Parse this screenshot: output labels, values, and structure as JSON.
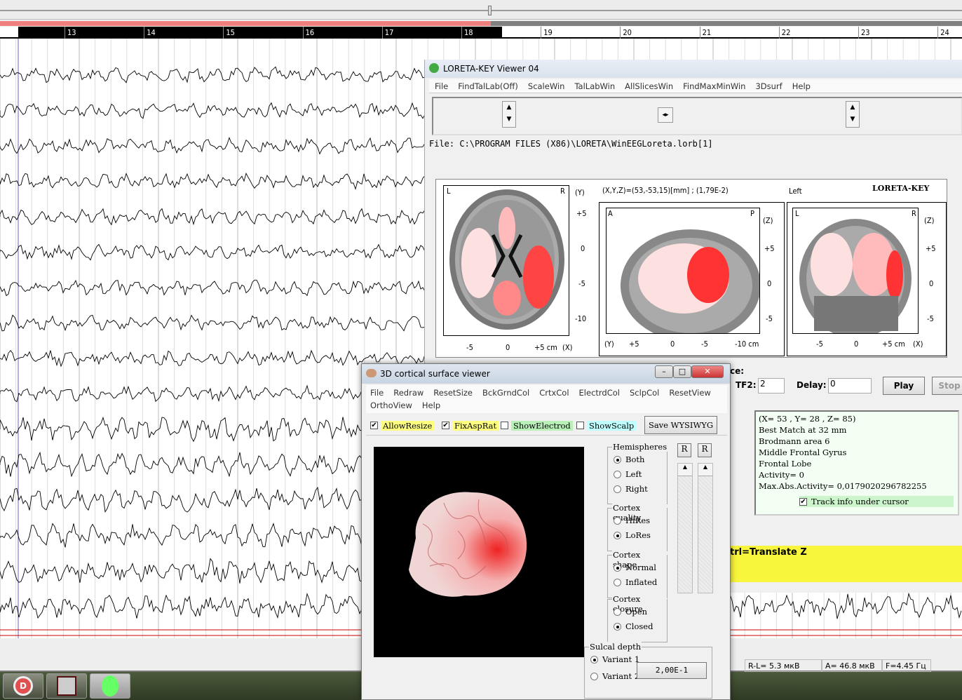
{
  "ruler": {
    "labels": [
      "13",
      "14",
      "15",
      "16",
      "17",
      "18",
      "19",
      "20",
      "21",
      "22",
      "23",
      "24"
    ],
    "progress_percent": 51
  },
  "loreta": {
    "title": "LORETA-KEY Viewer 04",
    "menu": [
      "File",
      "FindTalLab(Off)",
      "ScaleWin",
      "TalLabWin",
      "AllSlicesWin",
      "FindMaxMinWin",
      "3Dsurf",
      "Help"
    ],
    "file": "File: C:\\PROGRAM FILES (X86)\\LORETA\\WinEEGLoreta.lorb[1]",
    "coords": "(X,Y,Z)=(53,-53,15)[mm] ; (1,79E-2)",
    "side": "Left",
    "brand": "LORETA-KEY",
    "axial": {
      "left": "L",
      "right": "R",
      "axis": "(Y)",
      "yticks": [
        "+5",
        "0",
        "-5",
        "-10"
      ],
      "xticks": [
        "-5",
        "0",
        "+5 cm",
        "(X)"
      ]
    },
    "sagittal": {
      "left": "A",
      "right": "P",
      "axis": "(Z)",
      "yticks": [
        "+5",
        "0",
        "-5"
      ],
      "xticks": [
        "(Y)",
        "+5",
        "0",
        "-5",
        "-10 cm"
      ]
    },
    "coronal": {
      "left": "L",
      "right": "R",
      "axis": "(Z)",
      "yticks": [
        "+5",
        "0",
        "-5"
      ],
      "xticks": [
        "-5",
        "0",
        "+5 cm",
        "(X)"
      ]
    },
    "controls": {
      "section_label": "ce:",
      "tf2_label": "TF2:",
      "tf2_value": "2",
      "delay_label": "Delay:",
      "delay_value": "0",
      "play": "Play",
      "stop": "Stop"
    },
    "info": [
      "(X= 53 , Y= 28 , Z= 85)",
      "Best Match at 32 mm",
      "Brodmann area 6",
      "Middle Frontal Gyrus",
      "Frontal Lobe",
      "Activity= 0",
      "Max.Abs.Activity= 0,0179020296782255"
    ],
    "track_label": "Track info under cursor",
    "track_checked": true,
    "hint": "trl=Translate Z"
  },
  "status": {
    "rl": "R-L=   5.3 мкВ",
    "a": "A=  46.8 мкВ",
    "f": "F=4.45 Гц"
  },
  "viewer": {
    "title": "3D cortical surface viewer",
    "menu": [
      "File",
      "Redraw",
      "ResetSize",
      "BckGrndCol",
      "CrtxCol",
      "ElectrdCol",
      "SclpCol",
      "ResetView",
      "OrthoView",
      "Help"
    ],
    "checks": [
      {
        "label": "AllowResize",
        "checked": true,
        "color": "#ffff80"
      },
      {
        "label": "FixAspRat",
        "checked": true,
        "color": "#ffff80"
      },
      {
        "label": "ShowElectrod",
        "checked": false,
        "color": "#b8f0b8"
      },
      {
        "label": "ShowScalp",
        "checked": false,
        "color": "#c0ffff"
      }
    ],
    "save": "Save WYSIWYG",
    "hemispheres": {
      "title": "Hemispheres",
      "options": [
        "Both",
        "Left",
        "Right"
      ],
      "selected": 0
    },
    "quality": {
      "title": "Cortex quality",
      "options": [
        "HiRes",
        "LoRes"
      ],
      "selected": 1
    },
    "shape": {
      "title": "Cortex shape",
      "options": [
        "Normal",
        "Inflated"
      ],
      "selected": 0
    },
    "closure": {
      "title": "Cortex closure",
      "options": [
        "Open",
        "Closed"
      ],
      "selected": 1
    },
    "sulcal": {
      "title": "Sulcal depth",
      "options": [
        "Variant 1",
        "Variant 2"
      ],
      "selected": 0,
      "value": "2,00E-1"
    },
    "r_buttons": [
      "R",
      "R"
    ]
  }
}
